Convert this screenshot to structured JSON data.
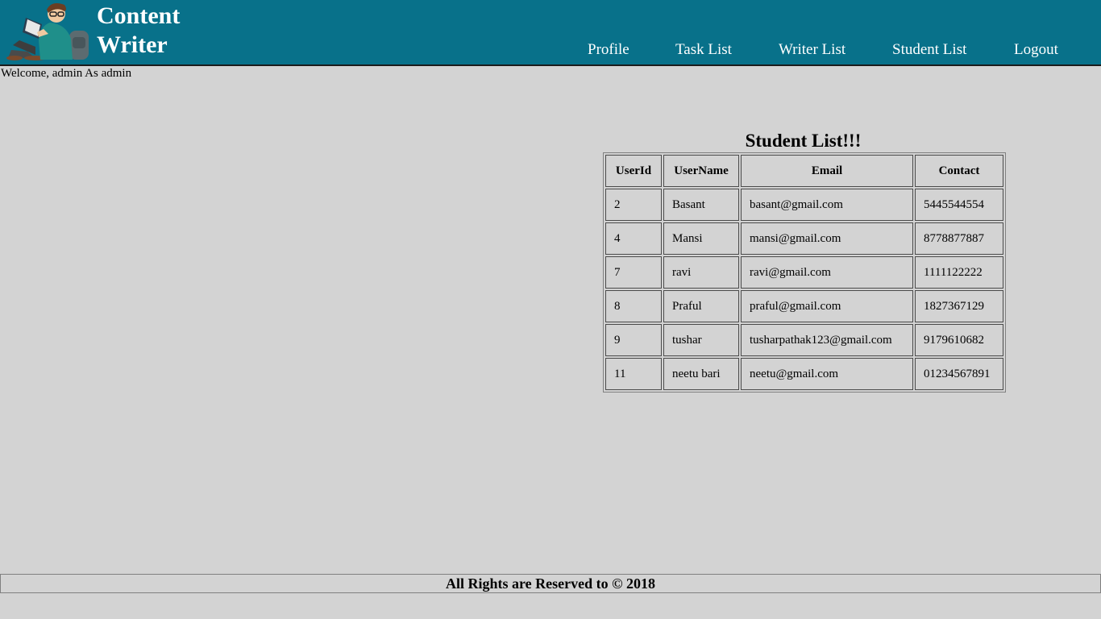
{
  "header": {
    "brand_line1": "Content",
    "brand_line2": "Writer",
    "nav": [
      "Profile",
      "Task List",
      "Writer List",
      "Student List",
      "Logout"
    ]
  },
  "welcome": "Welcome, admin As admin",
  "table": {
    "title": "Student List!!!",
    "columns": [
      "UserId",
      "UserName",
      "Email",
      "Contact"
    ],
    "rows": [
      [
        "2",
        "Basant",
        "basant@gmail.com",
        "5445544554"
      ],
      [
        "4",
        "Mansi",
        "mansi@gmail.com",
        "8778877887"
      ],
      [
        "7",
        "ravi",
        "ravi@gmail.com",
        "1111122222"
      ],
      [
        "8",
        "Praful",
        "praful@gmail.com",
        "1827367129"
      ],
      [
        "9",
        "tushar",
        "tusharpathak123@gmail.com",
        "9179610682"
      ],
      [
        "11",
        "neetu bari",
        "neetu@gmail.com",
        "01234567891"
      ]
    ]
  },
  "footer": "All Rights are Reserved to © 2018",
  "colors": {
    "header_bg": "#08718a",
    "page_bg": "#d3d3d3",
    "header_text": "#ffffff"
  },
  "icons": {
    "logo": "student-reading-logo-icon"
  }
}
